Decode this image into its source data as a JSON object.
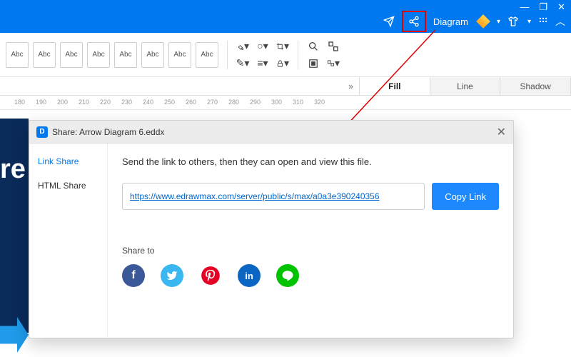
{
  "titlebar": {
    "doc_label": "Diagram",
    "icons": {
      "send": "send-icon",
      "share": "share-icon",
      "shirt": "shirt-icon",
      "apps": "apps-icon",
      "collapse": "chevron-up-icon"
    }
  },
  "window_controls": {
    "min": "—",
    "max": "❐",
    "close": "✕"
  },
  "abc_boxes": [
    "Abc",
    "Abc",
    "Abc",
    "Abc",
    "Abc",
    "Abc",
    "Abc",
    "Abc"
  ],
  "ruler_ticks": [
    "180",
    "190",
    "200",
    "210",
    "220",
    "230",
    "240",
    "250",
    "260",
    "270",
    "280",
    "290",
    "300",
    "310",
    "320"
  ],
  "side_tabs": {
    "expand": "»",
    "fill": "Fill",
    "line": "Line",
    "shadow": "Shadow"
  },
  "canvas_fragment": {
    "text": "re"
  },
  "dialog": {
    "title": "Share: Arrow Diagram 6.eddx",
    "side": {
      "link_share": "Link Share",
      "html_share": "HTML Share"
    },
    "descr": "Send the link to others, then they can open and view this file.",
    "url": "https://www.edrawmax.com/server/public/s/max/a0a3e390240356",
    "copy": "Copy Link",
    "share_to": "Share to",
    "social": {
      "fb": "f",
      "tw": "t",
      "pin": "P",
      "li": "in",
      "line": "L"
    }
  }
}
